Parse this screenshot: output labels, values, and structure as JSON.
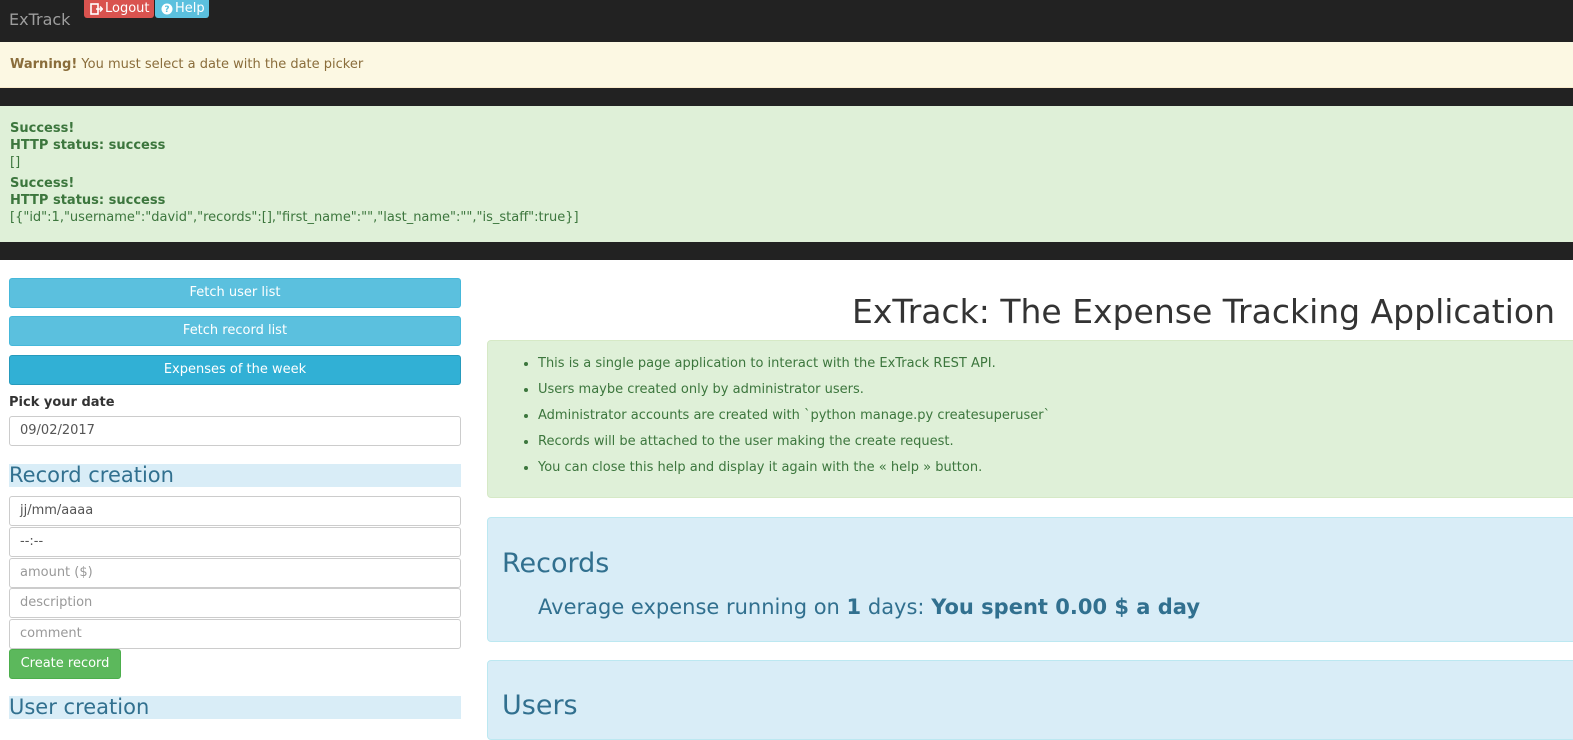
{
  "navbar": {
    "brand": "ExTrack",
    "logout_label": "Logout",
    "help_label": "Help"
  },
  "warning": {
    "title": "Warning!",
    "message": "You must select a date with the date picker"
  },
  "success_messages": [
    {
      "title": "Success!",
      "status": "HTTP status: success",
      "body": "[]"
    },
    {
      "title": "Success!",
      "status": "HTTP status: success",
      "body": "[{\"id\":1,\"username\":\"david\",\"records\":[],\"first_name\":\"\",\"last_name\":\"\",\"is_staff\":true}]"
    }
  ],
  "sidebar": {
    "fetch_users_label": "Fetch user list",
    "fetch_records_label": "Fetch record list",
    "week_expenses_label": "Expenses of the week",
    "pick_date_label": "Pick your date",
    "pick_date_value": "09/02/2017",
    "record_creation_title": "Record creation",
    "date_placeholder": "jj/mm/aaaa",
    "time_placeholder": "--:--",
    "amount_placeholder": "amount ($)",
    "description_placeholder": "description",
    "comment_placeholder": "comment",
    "create_record_label": "Create record",
    "user_creation_title": "User creation"
  },
  "main": {
    "title": "ExTrack: The Expense Tracking Application",
    "help_items": [
      "This is a single page application to interact with the ExTrack REST API.",
      "Users maybe created only by administrator users.",
      "Administrator accounts are created with `python manage.py createsuperuser`",
      "Records will be attached to the user making the create request.",
      "You can close this help and display it again with the « help » button."
    ],
    "records_title": "Records",
    "avg_prefix": "Average expense running on",
    "avg_days": "1",
    "avg_days_suffix": "days:",
    "avg_result": "You spent 0.00 $ a day",
    "users_title": "Users"
  },
  "colors": {
    "navbar": "#222222",
    "danger": "#d9534f",
    "info": "#5bc0de",
    "success": "#5cb85c",
    "warning_bg": "#fcf8e3",
    "success_bg": "#dff0d8",
    "info_bg": "#d9edf7"
  }
}
